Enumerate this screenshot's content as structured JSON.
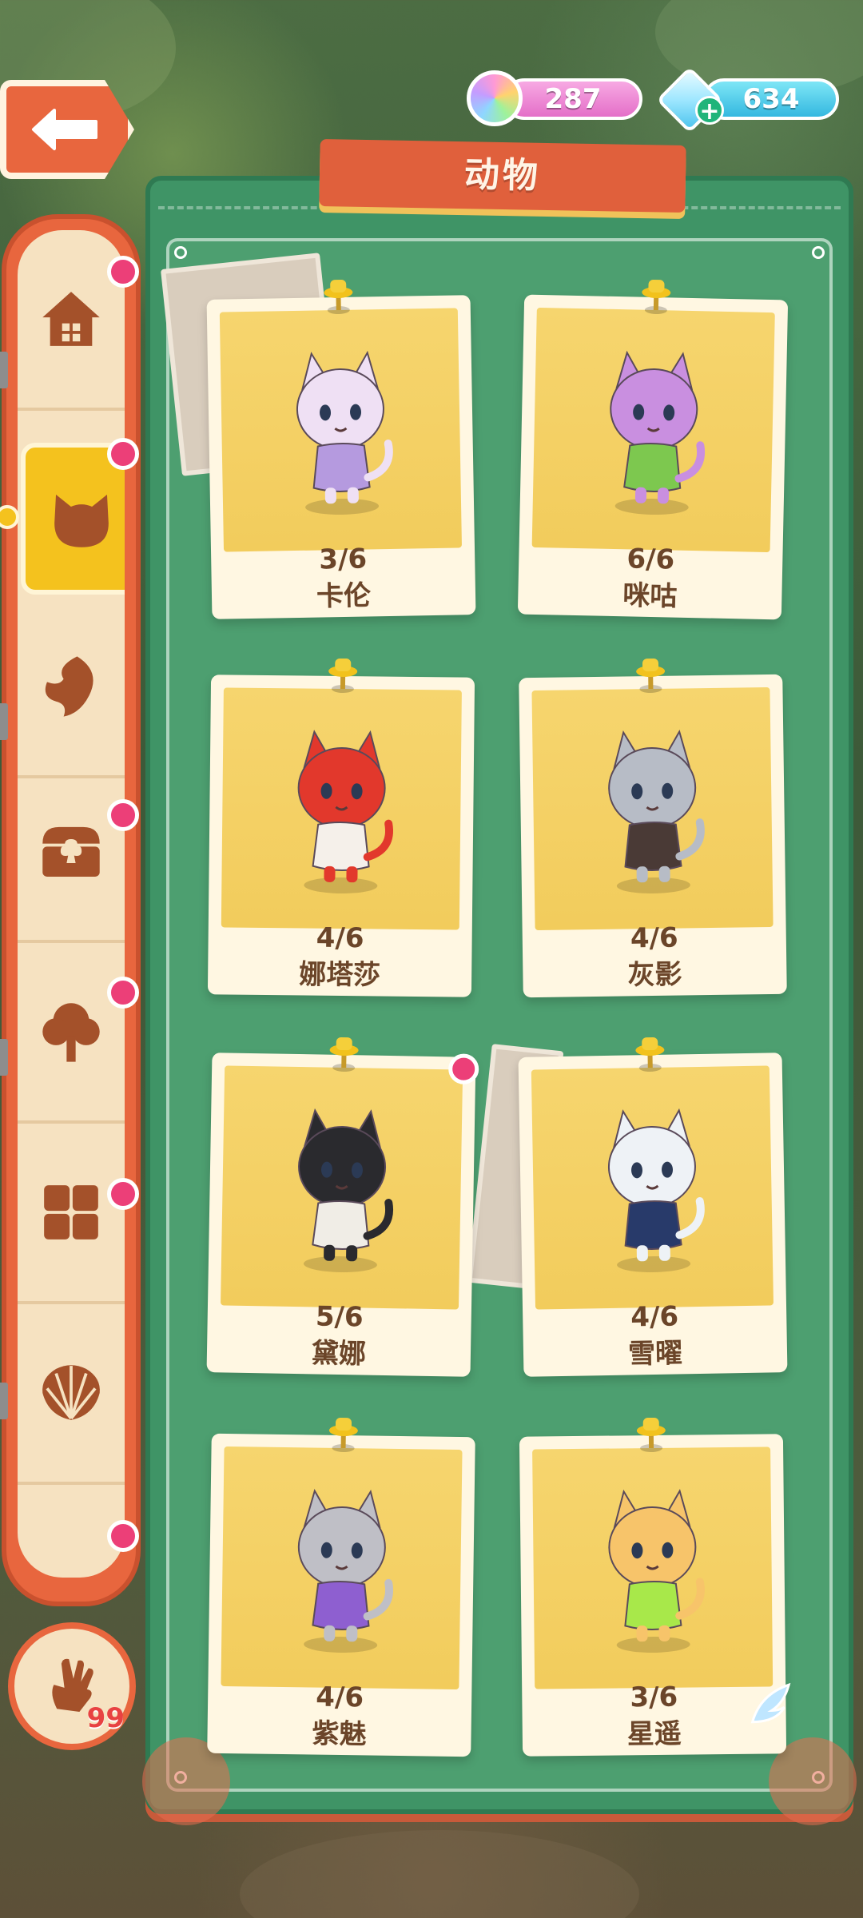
{
  "header": {
    "back_label": "back",
    "rainbow_count": "287",
    "gem_count": "634",
    "gem_add": "+"
  },
  "title": "动物",
  "sidebar": {
    "items": [
      {
        "icon": "house-icon",
        "badge": true,
        "active": false
      },
      {
        "icon": "cat-face-icon",
        "badge": true,
        "active": true
      },
      {
        "icon": "leaf-icon",
        "badge": false,
        "active": false
      },
      {
        "icon": "chest-icon",
        "badge": true,
        "active": false
      },
      {
        "icon": "tree-icon",
        "badge": true,
        "active": false
      },
      {
        "icon": "grid-icon",
        "badge": true,
        "active": false
      },
      {
        "icon": "shell-icon",
        "badge": false,
        "active": false
      }
    ],
    "hand_count": "99"
  },
  "cards": [
    {
      "progress": "3/6",
      "name": "卡伦",
      "color": "#efe0f4",
      "accent": "#b59adf",
      "badge": false
    },
    {
      "progress": "6/6",
      "name": "咪咕",
      "color": "#c98fe0",
      "accent": "#7dc84f",
      "badge": false
    },
    {
      "progress": "4/6",
      "name": "娜塔莎",
      "color": "#e2382c",
      "accent": "#f5f0ea",
      "badge": false
    },
    {
      "progress": "4/6",
      "name": "灰影",
      "color": "#b7bcc6",
      "accent": "#4a3a36",
      "badge": false
    },
    {
      "progress": "5/6",
      "name": "黛娜",
      "color": "#2a2a2e",
      "accent": "#f0ede6",
      "badge": true
    },
    {
      "progress": "4/6",
      "name": "雪曜",
      "color": "#eef2f6",
      "accent": "#283a6a",
      "badge": false
    },
    {
      "progress": "4/6",
      "name": "紫魅",
      "color": "#bfbfc6",
      "accent": "#8e5fd0",
      "badge": false
    },
    {
      "progress": "3/6",
      "name": "星遥",
      "color": "#f7c46a",
      "accent": "#a8e84a",
      "badge": false
    }
  ],
  "colors": {
    "board": "#3f9466",
    "accent_orange": "#e8663e",
    "badge_pink": "#ec3f78",
    "active_yellow": "#f4c21e"
  }
}
